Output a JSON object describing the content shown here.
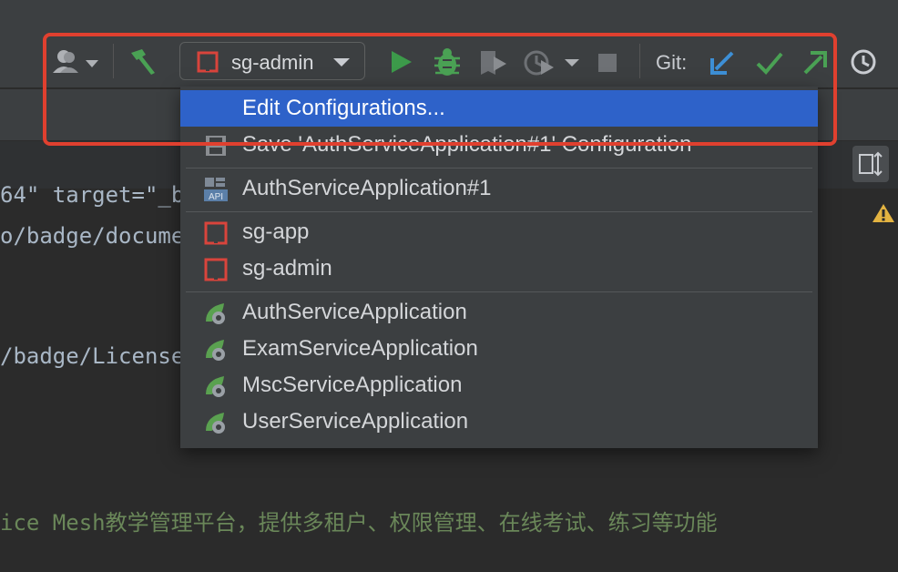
{
  "toolbar": {
    "run_config": "sg-admin",
    "git_label": "Git:"
  },
  "dropdown": {
    "edit_label": "Edit Configurations...",
    "save_label": "Save 'AuthServiceApplication#1' Configuration",
    "temporary": [
      "AuthServiceApplication#1"
    ],
    "maven": [
      "sg-app",
      "sg-admin"
    ],
    "spring": [
      "AuthServiceApplication",
      "ExamServiceApplication",
      "MscServiceApplication",
      "UserServiceApplication"
    ]
  },
  "editor": {
    "lines": [
      "64\" target=\"_b",
      "o/badge/docume",
      "/badge/License",
      "ice Mesh教学管理平台，提供多租户、权限管理、在线考试、练习等功能"
    ]
  },
  "colors": {
    "accent": "#2e62c9",
    "highlight": "#e0402f",
    "run_green": "#3c9a4a",
    "git_blue": "#3d8fd6",
    "git_green": "#4aa154"
  }
}
